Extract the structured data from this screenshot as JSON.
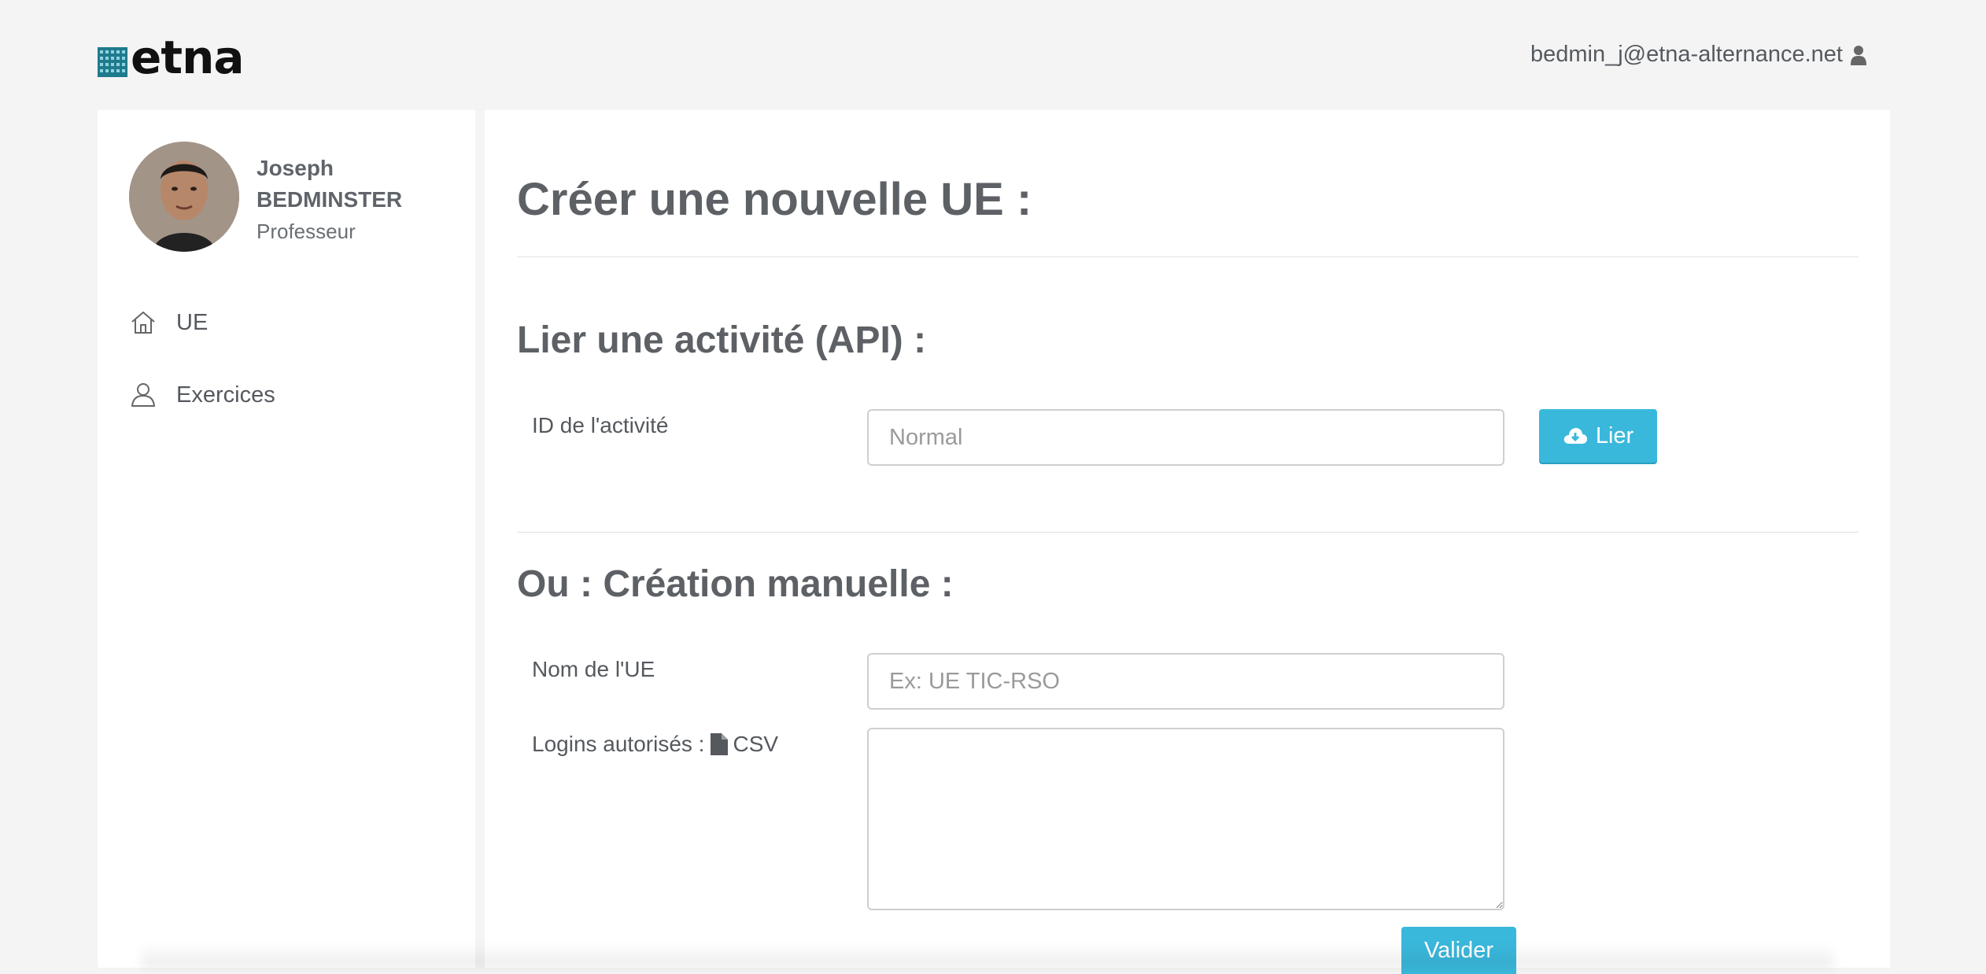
{
  "header": {
    "logo_text": "etna",
    "user_email": "bedmin_j@etna-alternance.net"
  },
  "profile": {
    "first_name": "Joseph",
    "last_name": "BEDMINSTER",
    "role": "Professeur"
  },
  "nav": {
    "items": [
      {
        "label": "UE",
        "icon": "home-icon"
      },
      {
        "label": "Exercices",
        "icon": "user-icon"
      }
    ]
  },
  "page": {
    "title": "Créer une nouvelle UE :",
    "api_section": {
      "heading": "Lier une activité (API) :",
      "field_label": "ID de l'activité",
      "field_placeholder": "Normal",
      "button_label": "Lier"
    },
    "manual_section": {
      "heading": "Ou : Création manuelle :",
      "name_label": "Nom de l'UE",
      "name_placeholder": "Ex: UE TIC-RSO",
      "logins_label": "Logins autorisés :",
      "csv_label": "CSV",
      "submit_label": "Valider"
    }
  },
  "colors": {
    "accent": "#3ab8dc",
    "background": "#f4f4f4",
    "logo_mark": "#1f7a8c"
  }
}
